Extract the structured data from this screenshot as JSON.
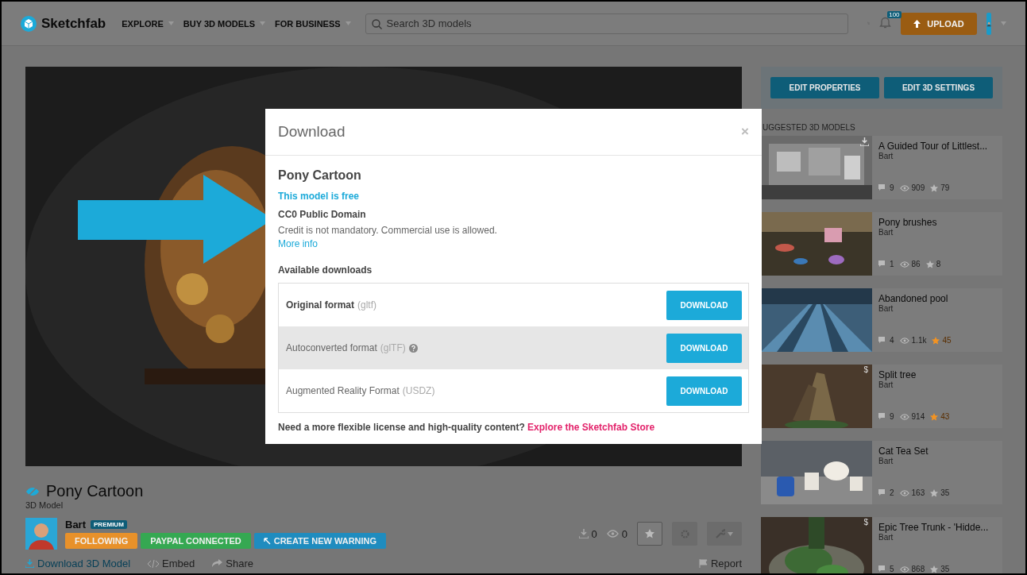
{
  "header": {
    "logo": "Sketchfab",
    "nav": [
      "EXPLORE",
      "BUY 3D MODELS",
      "FOR BUSINESS"
    ],
    "search": {
      "placeholder": "Search 3D models"
    },
    "notifications": "100",
    "upload": "UPLOAD"
  },
  "model": {
    "title": "Pony Cartoon",
    "hidden": true,
    "subtitle": "3D Model",
    "author": "Bart",
    "author_badge": "PREMIUM",
    "tags": [
      {
        "label": "FOLLOWING",
        "color": "#e8912a"
      },
      {
        "label": "PAYPAL CONNECTED",
        "color": "#35a852"
      },
      {
        "label": "CREATE NEW WARNING",
        "color": "#1f8cbf"
      }
    ],
    "downloads": "0",
    "views": "0",
    "liked": false,
    "links": [
      "Download 3D Model",
      "Embed",
      "Share"
    ],
    "report": "Report"
  },
  "sidebar": {
    "buttons": [
      "EDIT PROPERTIES",
      "EDIT 3D SETTINGS"
    ],
    "section_title": "UGGESTED 3D MODELS",
    "items": [
      {
        "title": "A Guided Tour of Littlest...",
        "author": "Bart",
        "comments": "9",
        "views": "909",
        "likes": "79",
        "liked": false,
        "downloadable": true
      },
      {
        "title": "Pony brushes",
        "author": "Bart",
        "comments": "1",
        "views": "86",
        "likes": "8",
        "liked": false,
        "downloadable": false
      },
      {
        "title": "Abandoned pool",
        "author": "Bart",
        "comments": "4",
        "views": "1.1k",
        "likes": "45",
        "liked": true,
        "downloadable": false
      },
      {
        "title": "Split tree",
        "author": "Bart",
        "comments": "9",
        "views": "914",
        "likes": "43",
        "liked": true,
        "downloadable": false,
        "price_mark": "$"
      },
      {
        "title": "Cat Tea Set",
        "author": "Bart",
        "comments": "2",
        "views": "163",
        "likes": "35",
        "liked": false,
        "downloadable": false
      },
      {
        "title": "Epic Tree Trunk - 'Hidde...",
        "author": "Bart",
        "comments": "5",
        "views": "868",
        "likes": "35",
        "liked": false,
        "downloadable": false,
        "price_mark": "$"
      }
    ]
  },
  "dialog": {
    "title": "Download",
    "close": "×",
    "model_name": "Pony Cartoon",
    "price_note": "This model is free",
    "license": "CC0 Public Domain",
    "license_text": "Credit is not mandatory. Commercial use is allowed.",
    "more_info": "More info",
    "section_title": "Available downloads",
    "formats": [
      {
        "name": "Original format",
        "ext": "(gltf)",
        "emphasized": true,
        "highlighted": false,
        "help": false,
        "button": "DOWNLOAD"
      },
      {
        "name": "Autoconverted format",
        "ext": "(glTF)",
        "emphasized": false,
        "highlighted": true,
        "help": true,
        "button": "DOWNLOAD"
      },
      {
        "name": "Augmented Reality Format",
        "ext": "(USDZ)",
        "emphasized": false,
        "highlighted": false,
        "help": false,
        "button": "DOWNLOAD"
      }
    ],
    "footer_text": "Need a more flexible license and high-quality content?",
    "footer_link": "Explore the Sketchfab Store"
  },
  "annotation": {
    "kind": "arrow"
  }
}
